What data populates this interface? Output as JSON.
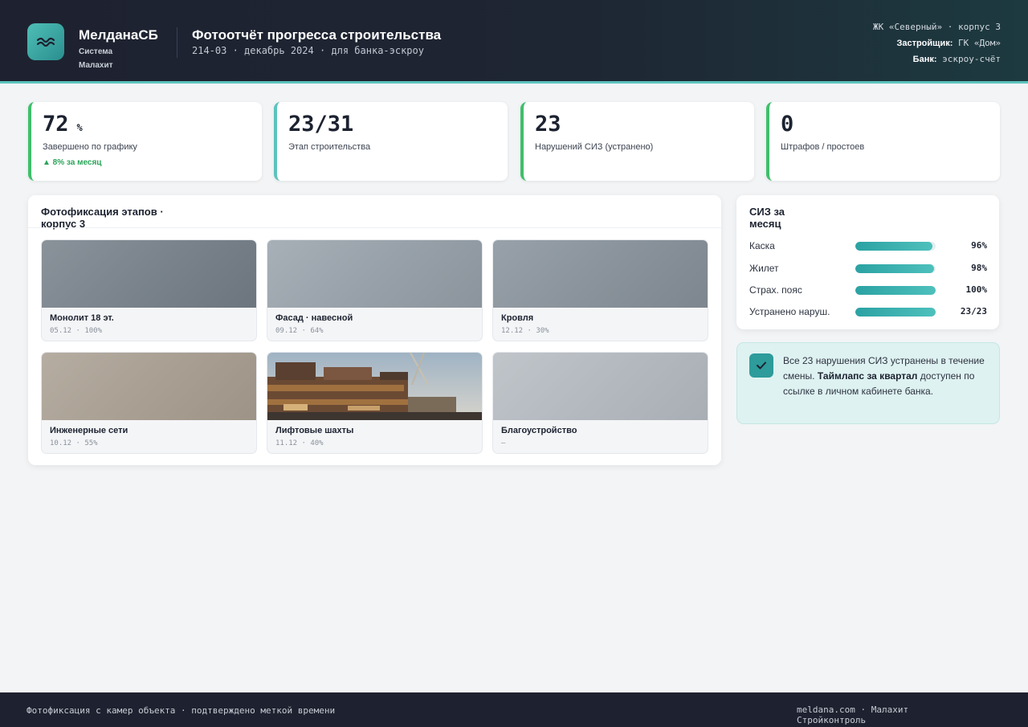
{
  "header": {
    "brand_name": "МелданаСБ",
    "brand_sub": "Система Малахит",
    "title": "Фотоотчёт прогресса строительства",
    "subtitle": "214-03 · декабрь 2024 · для банка-эскроу",
    "project": "ЖК «Северный» · корпус 3",
    "developer_label": "Застройщик:",
    "developer": "ГК «Дом»",
    "bank_label": "Банк:",
    "bank": "эскроу-счёт",
    "icon": "waves-icon"
  },
  "kpis": [
    {
      "value": "72",
      "unit": "%",
      "label": "Завершено по графику",
      "delta": "▲ 8% за месяц",
      "accent": "#3fbf6b"
    },
    {
      "value": "23/31",
      "label": "Этап строительства",
      "accent": "#5cc3bd"
    },
    {
      "value": "23",
      "label": "Нарушений СИЗ (устранено)",
      "accent": "#3fbf6b"
    },
    {
      "value": "0",
      "label": "Штрафов / простоев",
      "accent": "#3fbf6b"
    }
  ],
  "photos": {
    "title": "Фотофиксация этапов · корпус 3",
    "items": [
      {
        "caption": "Монолит 18 эт.",
        "meta": "05.12 · 100%"
      },
      {
        "caption": "Фасад · навесной",
        "meta": "09.12 · 64%"
      },
      {
        "caption": "Кровля",
        "meta": "12.12 · 30%"
      },
      {
        "caption": "Инженерные сети",
        "meta": "10.12 · 55%"
      },
      {
        "caption": "Лифтовые шахты",
        "meta": "11.12 · 40%"
      },
      {
        "caption": "Благоустройство",
        "meta": "—"
      }
    ]
  },
  "siz": {
    "title": "СИЗ за месяц",
    "rows": [
      {
        "label": "Каска",
        "value": "96%",
        "fill": 0.96
      },
      {
        "label": "Жилет",
        "value": "98%",
        "fill": 0.98
      },
      {
        "label": "Страх. пояс",
        "value": "100%",
        "fill": 1.0
      },
      {
        "label": "Устранено наруш.",
        "value": "23/23",
        "fill": 1.0
      }
    ]
  },
  "note": {
    "text_1": "Все 23 нарушения СИЗ устранены в течение смены.",
    "text_bold": "Таймлапс за квартал",
    "text_2": "доступен по ссылке в личном кабинете банка.",
    "icon": "check-icon"
  },
  "footer": {
    "left": "Фотофиксация с камер объекта · подтверждено меткой времени",
    "right": "meldana.com · Малахит Стройконтроль"
  },
  "colors": {
    "accent": "#5cc3bd",
    "success": "#3fbf6b",
    "header_bg": "#1e2230"
  }
}
